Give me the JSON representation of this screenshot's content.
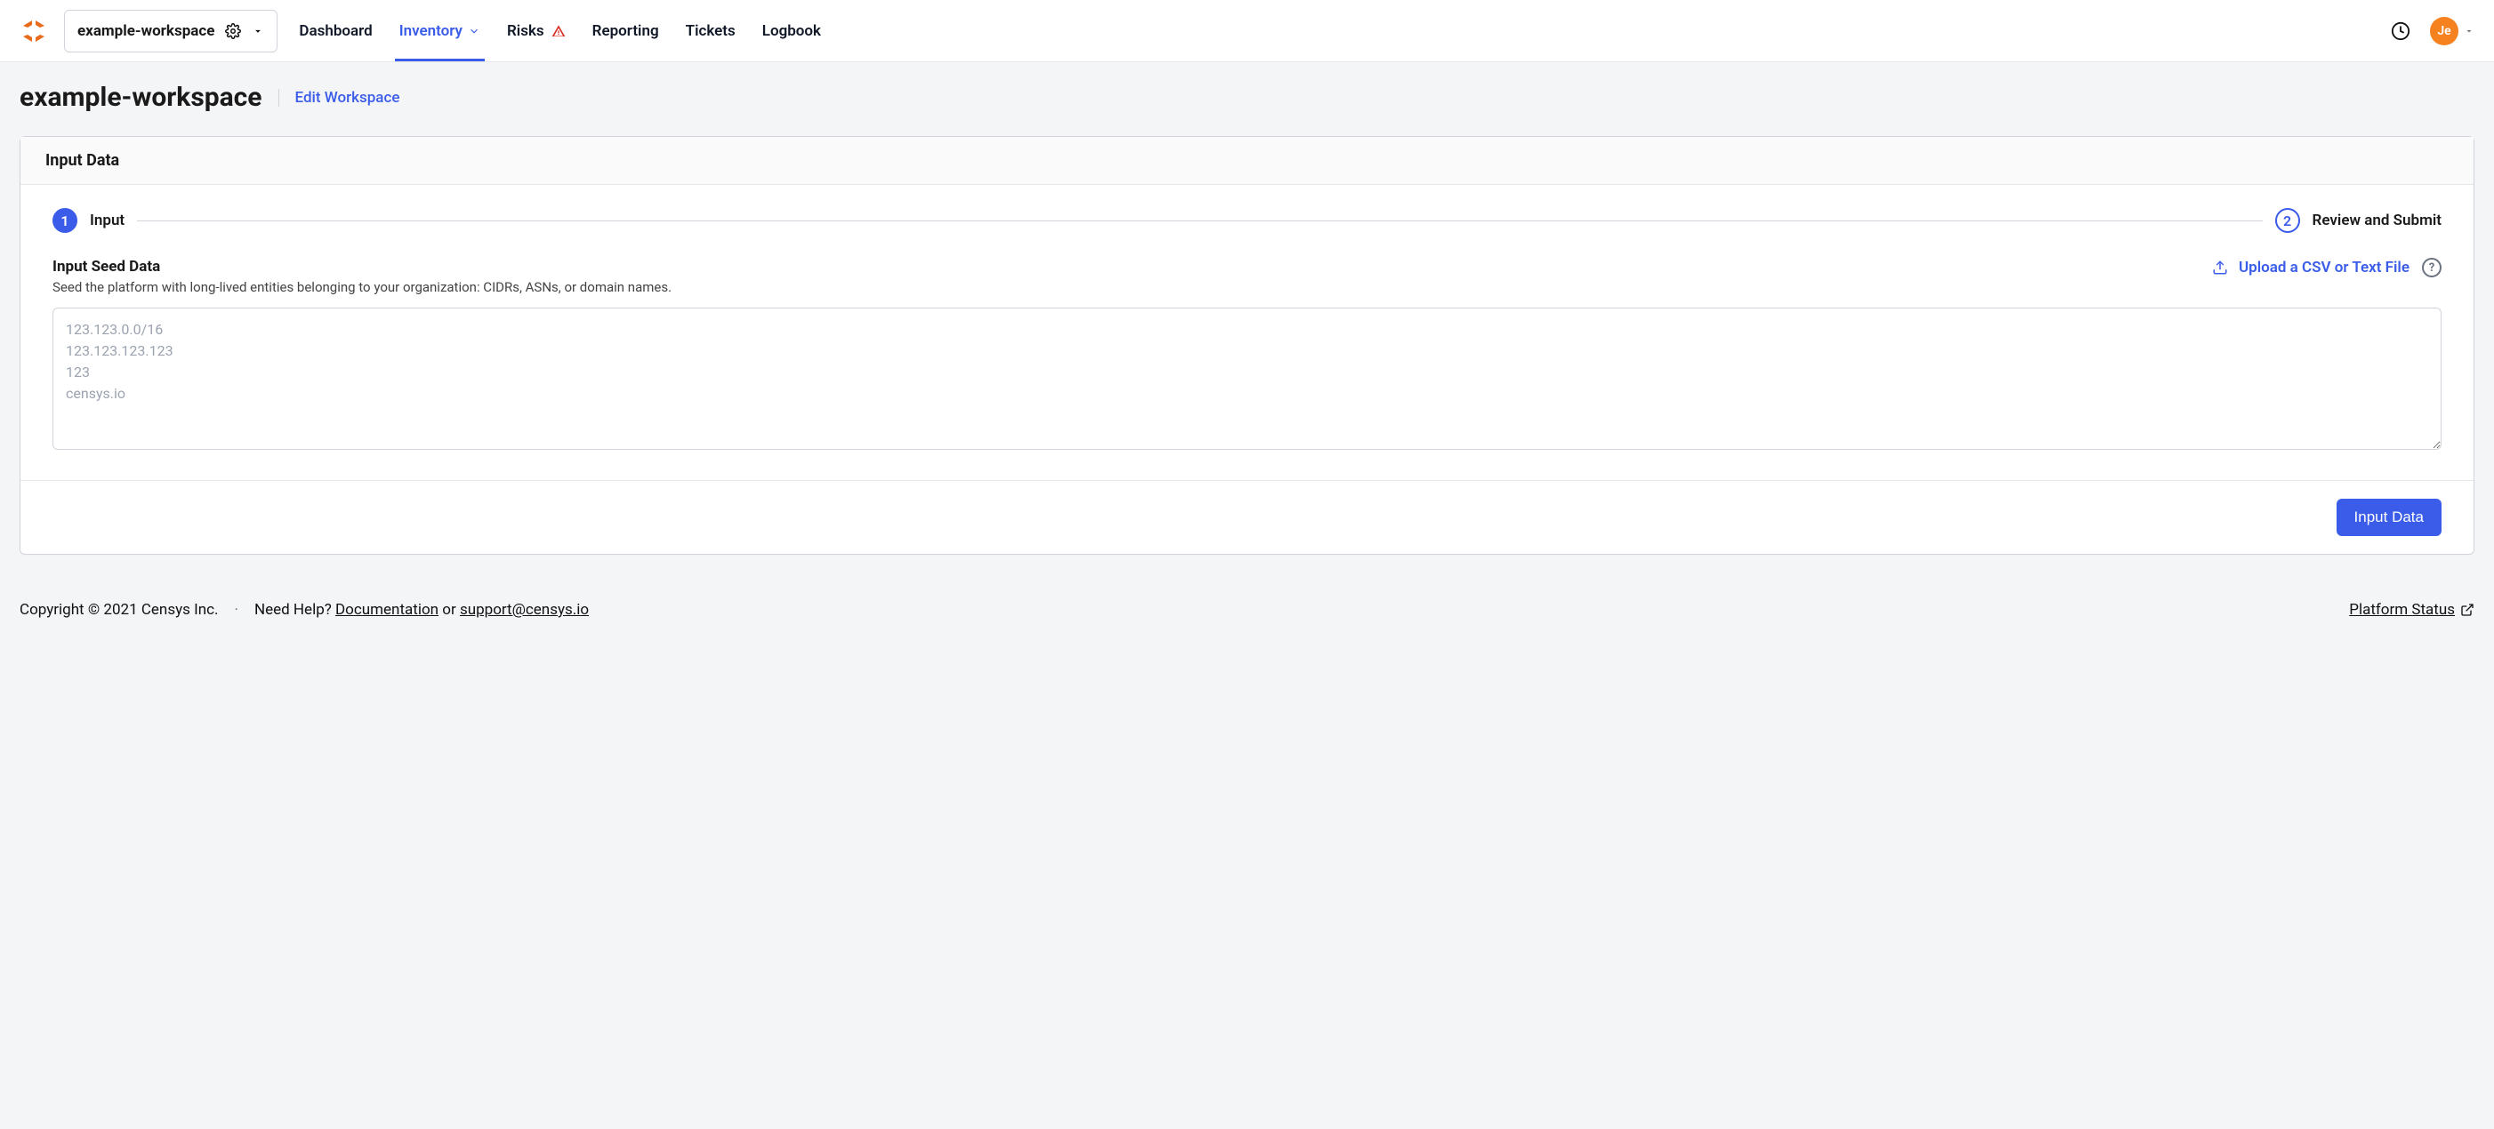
{
  "workspace": {
    "name": "example-workspace"
  },
  "nav": {
    "dashboard": "Dashboard",
    "inventory": "Inventory",
    "risks": "Risks",
    "reporting": "Reporting",
    "tickets": "Tickets",
    "logbook": "Logbook"
  },
  "user": {
    "initials": "Je"
  },
  "page": {
    "title": "example-workspace",
    "edit_link": "Edit Workspace"
  },
  "card": {
    "header": "Input Data",
    "steps": {
      "one_label": "Input",
      "two_label": "Review and Submit"
    },
    "seed": {
      "title": "Input Seed Data",
      "description": "Seed the platform with long-lived entities belonging to your organization: CIDRs, ASNs, or domain names.",
      "upload_label": "Upload a CSV or Text File",
      "placeholder": "123.123.0.0/16\n123.123.123.123\n123\ncensys.io",
      "value": ""
    },
    "submit_label": "Input Data"
  },
  "footer": {
    "copyright": "Copyright © 2021 Censys Inc.",
    "need_help_label": "Need Help?",
    "documentation": "Documentation",
    "or": "or",
    "support_email": "support@censys.io",
    "platform_status": "Platform Status"
  }
}
